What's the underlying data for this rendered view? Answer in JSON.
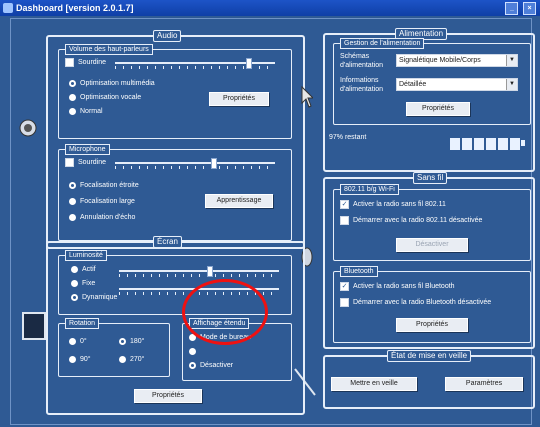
{
  "window": {
    "title": "Dashboard  [version 2.0.1.7]",
    "min": "_",
    "close": "×"
  },
  "audio": {
    "title": "Audio",
    "volume": {
      "title": "Volume des haut-parleurs",
      "mute": "Sourdine",
      "options": [
        "Optimisation multimédia",
        "Optimisation vocale",
        "Normal"
      ],
      "selected": 0,
      "properties": "Propriétés",
      "level": 0.82
    },
    "micro": {
      "title": "Microphone",
      "mute": "Sourdine",
      "options": [
        "Focalisation étroite",
        "Focalisation large",
        "Annulation d'écho"
      ],
      "selected": 0,
      "learn": "Apprentissage",
      "level": 0.6
    }
  },
  "ecran": {
    "title": "Écran",
    "luminosity": {
      "title": "Luminosité",
      "options": [
        "Actif",
        "Fixe",
        "Dynamique"
      ],
      "selected": 2,
      "level": 0.55
    },
    "rotation": {
      "title": "Rotation",
      "options": [
        "0°",
        "180°",
        "90°",
        "270°"
      ],
      "selected": 1
    },
    "virtual": {
      "title": "Affichage étendu",
      "options": [
        "Mode de bureau",
        "",
        "Désactiver"
      ],
      "selected": 2
    },
    "properties": "Propriétés"
  },
  "alimentation": {
    "title": "Alimentation",
    "schemas": {
      "title": "Gestion de l'alimentation",
      "label1": "Schémas d'alimentation",
      "value1": "Signalétique Mobile/Corps",
      "label2": "Informations d'alimentation",
      "value2": "Détaillée",
      "properties": "Propriétés"
    },
    "battery_text": "97% restant",
    "battery_level": 0.97
  },
  "sansfil": {
    "title": "Sans fil",
    "wifi": {
      "title": "802.11 b/g Wi-Fi",
      "opt1": "Activer la radio sans fil 802.11",
      "opt2": "Démarrer avec la radio 802.11 désactivée",
      "button": "Désactiver"
    },
    "bluetooth": {
      "title": "Bluetooth",
      "opt1": "Activer la radio sans fil Bluetooth",
      "opt2": "Démarrer avec la radio Bluetooth désactivée",
      "button": "Propriétés"
    }
  },
  "etat": {
    "title": "État de mise en veille",
    "btn1": "Mettre en veille",
    "btn2": "Paramètres"
  }
}
